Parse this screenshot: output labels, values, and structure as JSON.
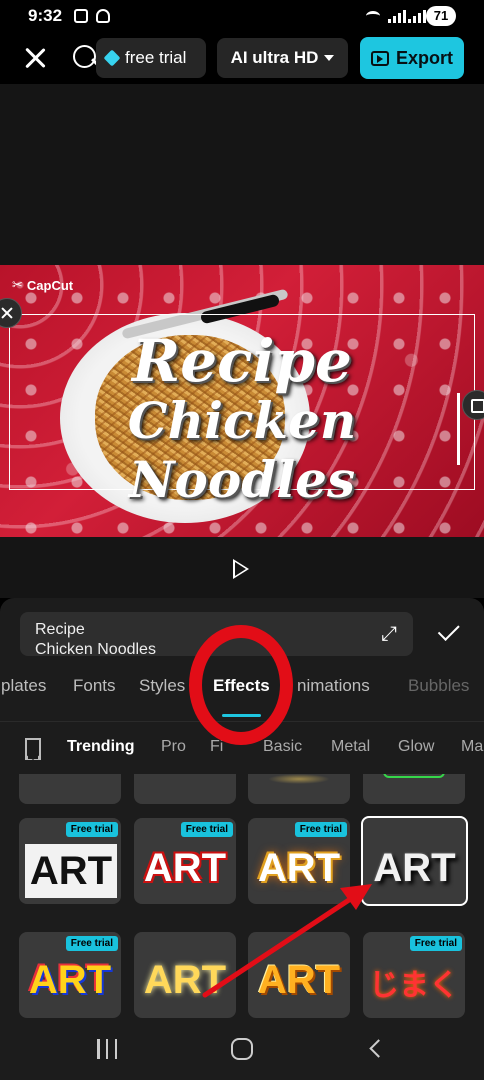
{
  "status_bar": {
    "time": "9:32",
    "battery": "71"
  },
  "toolbar": {
    "trial_label": "free trial",
    "quality_label": "AI ultra HD",
    "export_label": "Export"
  },
  "preview": {
    "watermark": "CapCut",
    "title_line1": "Recipe",
    "title_line2": "Chicken Noodles"
  },
  "editor": {
    "text_value": "Recipe\nChicken Noodles"
  },
  "tabs": [
    {
      "label": "plates"
    },
    {
      "label": "Fonts"
    },
    {
      "label": "Styles"
    },
    {
      "label": "Effects",
      "active": true
    },
    {
      "label": "nimations"
    },
    {
      "label": "Bubbles"
    }
  ],
  "subtabs": [
    {
      "label": "Trending",
      "active": true
    },
    {
      "label": "Pro"
    },
    {
      "label": "Fi"
    },
    {
      "label": "Basic"
    },
    {
      "label": "Metal"
    },
    {
      "label": "Glow"
    },
    {
      "label": "Ma"
    }
  ],
  "effects": {
    "badge": "Free trial",
    "tiles": [
      {
        "text": "ART",
        "badge": true
      },
      {
        "text": "ART",
        "badge": true
      },
      {
        "text": "ART",
        "badge": true
      },
      {
        "text": "ART",
        "badge": false,
        "selected": true
      },
      {
        "text": "ART",
        "badge": true
      },
      {
        "text": "ART",
        "badge": false
      },
      {
        "text": "ART",
        "badge": false
      },
      {
        "text": "じまく",
        "badge": true
      }
    ]
  },
  "colors": {
    "accent": "#1ec6e0",
    "annotation": "#e20d17"
  }
}
